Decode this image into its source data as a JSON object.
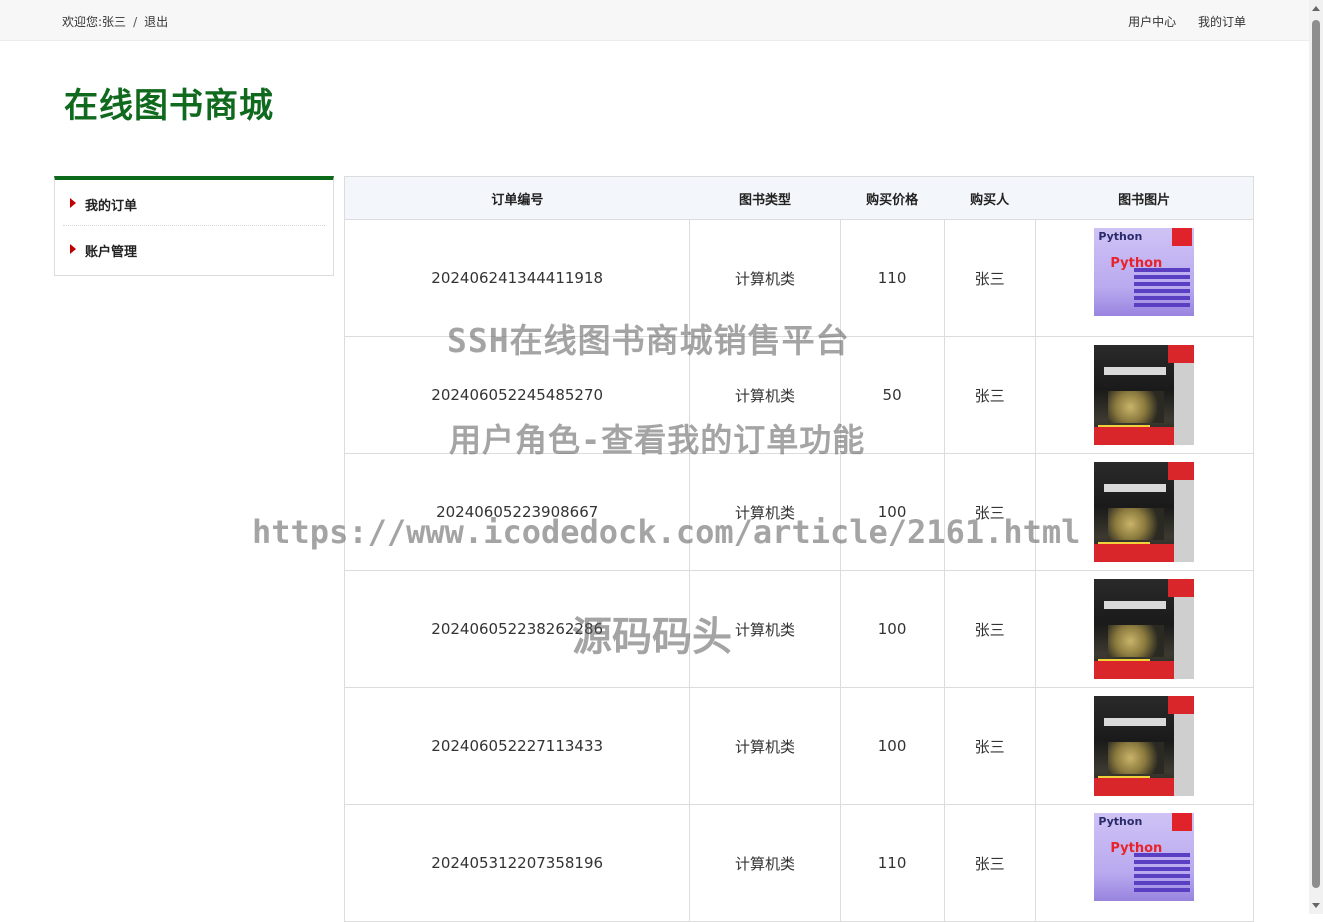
{
  "topbar": {
    "welcome": "欢迎您:",
    "username": "张三",
    "separator": "/",
    "logout": "退出",
    "links": [
      "用户中心",
      "我的订单"
    ]
  },
  "site_title": "在线图书商城",
  "sidebar": {
    "items": [
      {
        "label": "我的订单"
      },
      {
        "label": "账户管理"
      }
    ]
  },
  "table": {
    "headers": [
      "订单编号",
      "图书类型",
      "购买价格",
      "购买人",
      "图书图片"
    ],
    "rows": [
      {
        "order_no": "202406241344411918",
        "category": "计算机类",
        "price": "110",
        "buyer": "张三",
        "cover": "python-book-cover"
      },
      {
        "order_no": "202406052245485270",
        "category": "计算机类",
        "price": "50",
        "buyer": "张三",
        "cover": "csapp-book-cover"
      },
      {
        "order_no": "20240605223908667",
        "category": "计算机类",
        "price": "100",
        "buyer": "张三",
        "cover": "csapp-book-cover"
      },
      {
        "order_no": "202406052238262286",
        "category": "计算机类",
        "price": "100",
        "buyer": "张三",
        "cover": "csapp-book-cover"
      },
      {
        "order_no": "202406052227113433",
        "category": "计算机类",
        "price": "100",
        "buyer": "张三",
        "cover": "csapp-book-cover"
      },
      {
        "order_no": "202405312207358196",
        "category": "计算机类",
        "price": "110",
        "buyer": "张三",
        "cover": "python-book-cover"
      }
    ]
  },
  "watermark": {
    "line1": "SSH在线图书商城销售平台",
    "line2": "用户角色-查看我的订单功能",
    "line3": "https://www.icodedock.com/article/2161.html",
    "line4": "源码码头"
  },
  "colors": {
    "title_green": "#0f6a1e",
    "sidebar_accent": "#0c6a1a",
    "arrow_red": "#c00000",
    "table_header_bg": "#f3f6fa"
  }
}
